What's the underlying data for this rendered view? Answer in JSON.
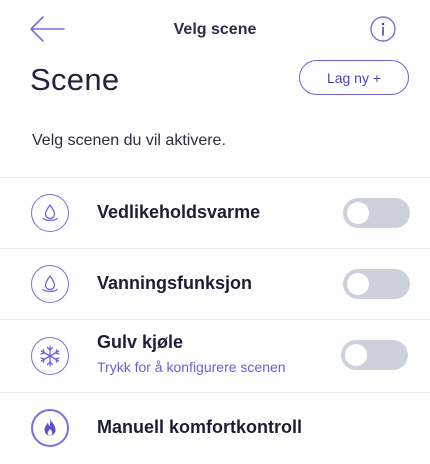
{
  "header": {
    "title": "Velg scene",
    "back_icon": "arrow-left-icon",
    "info_icon": "info-icon"
  },
  "page": {
    "heading": "Scene",
    "new_button_label": "Lag ny +",
    "description": "Velg scenen du vil aktivere."
  },
  "colors": {
    "accent": "#6f63d9",
    "toggle_off": "#ccd1dc"
  },
  "scenes": [
    {
      "title": "Vedlikeholdsvarme",
      "subtitle": "",
      "icon": "water-drop-icon",
      "toggle": "off"
    },
    {
      "title": "Vanningsfunksjon",
      "subtitle": "",
      "icon": "water-drop-icon",
      "toggle": "off"
    },
    {
      "title": "Gulv kjøle",
      "subtitle": "Trykk for å konfigurere scenen",
      "icon": "snowflake-icon",
      "toggle": "off"
    },
    {
      "title": "Manuell komfortkontroll",
      "subtitle": "",
      "icon": "flame-icon"
    }
  ]
}
